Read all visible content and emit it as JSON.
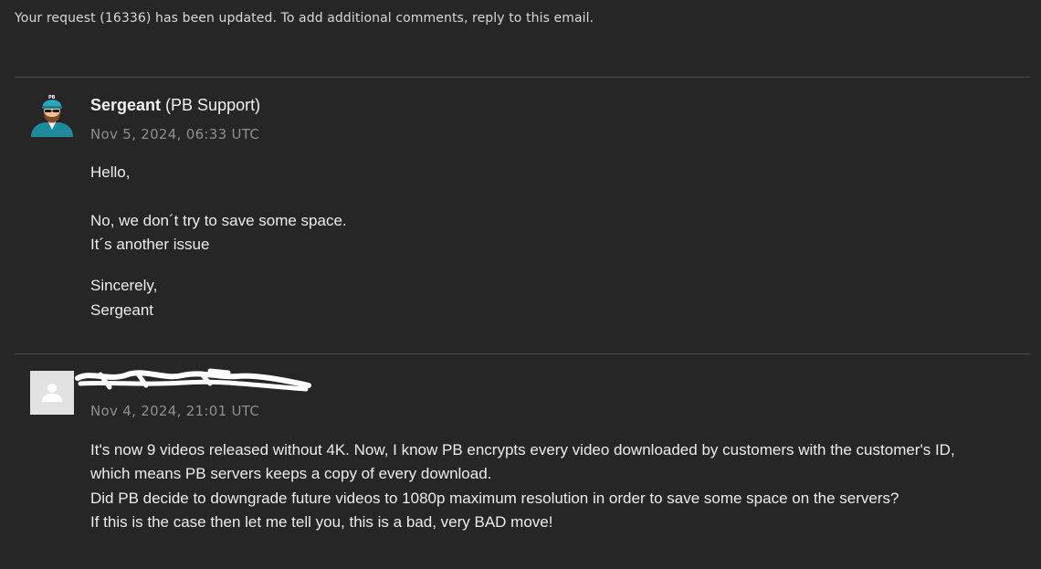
{
  "notice": "Your request (16336) has been updated. To add additional comments, reply to this email.",
  "comments": [
    {
      "author_name": "Sergeant",
      "author_role": "(PB Support)",
      "timestamp": "Nov 5, 2024, 06:33 UTC",
      "lines": [
        "Hello,",
        "No, we don´t try to save some space.",
        "It´s another issue",
        "Sincerely,",
        "Sergeant"
      ],
      "avatar_icon": "support-agent-avatar",
      "avatar_badge": "PB"
    },
    {
      "author_name": "",
      "timestamp": "Nov 4, 2024, 21:01 UTC",
      "lines": [
        "It's now 9 videos released without 4K. Now, I know PB encrypts every video downloaded by customers with the customer's ID,",
        "which means PB servers keeps a copy of every download.",
        "Did PB decide to downgrade future videos to 1080p maximum resolution in order to save some space on the servers?",
        "If this is the case then let me tell you, this is a bad, very BAD move!"
      ],
      "avatar_icon": "default-user-avatar"
    }
  ],
  "colors": {
    "background": "#262626",
    "divider": "#4a4a4a",
    "timestamp": "#8f8f8f",
    "text": "#ececec",
    "agent_teal": "#1f8a9c"
  }
}
